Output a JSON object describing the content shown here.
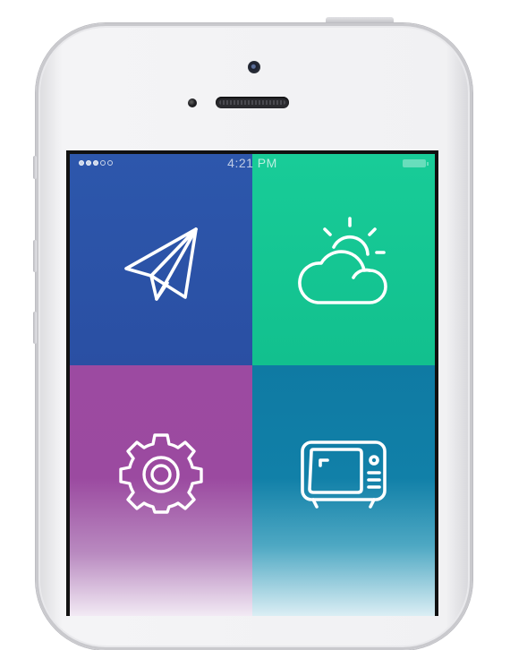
{
  "status_bar": {
    "time": "4:21 PM",
    "signal_dots_filled": 3,
    "signal_dots_total": 5,
    "battery_level": 1.0
  },
  "tiles": [
    {
      "name": "messages",
      "icon": "paper-plane-icon",
      "color": "#2c55aa"
    },
    {
      "name": "weather",
      "icon": "sun-cloud-icon",
      "color": "#17c896"
    },
    {
      "name": "settings",
      "icon": "gear-icon",
      "color": "#9c4aa1"
    },
    {
      "name": "tv",
      "icon": "tv-icon",
      "color": "#0f7aa3"
    }
  ],
  "device": {
    "color": "#f1f1f3"
  }
}
